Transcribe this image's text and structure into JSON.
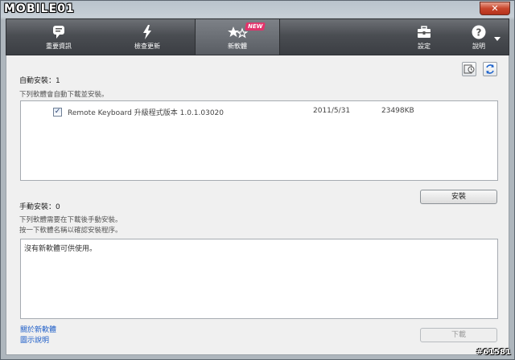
{
  "brand": {
    "logo_text": "MOBILE01"
  },
  "window": {
    "close_label": "✕"
  },
  "toolbar": {
    "items": [
      {
        "label": "重要資訊",
        "icon": "speech-bubble-icon"
      },
      {
        "label": "檢查更新",
        "icon": "lightning-icon"
      },
      {
        "label": "新軟體",
        "icon": "stars-icon",
        "badge": "NEW",
        "active": true
      },
      {
        "label": "設定",
        "icon": "toolbox-icon"
      },
      {
        "label": "說明",
        "icon": "help-icon"
      }
    ]
  },
  "auto_install": {
    "title": "自動安裝：1",
    "description": "下列軟體會自動下載並安裝。",
    "items": [
      {
        "checked": true,
        "name": "Remote Keyboard 升級程式版本 1.0.1.03020",
        "date": "2011/5/31",
        "size": "23498KB"
      }
    ],
    "install_button": "安裝"
  },
  "manual_install": {
    "title": "手動安裝：0",
    "description_line1": "下列軟體需要在下載後手動安裝。",
    "description_line2": "按一下軟體名稱以確認安裝程序。",
    "empty_message": "沒有新軟體可供使用。",
    "download_button": "下載"
  },
  "links": {
    "about": "關於新軟體",
    "legend": "圖示說明"
  },
  "watermark": "#61581",
  "colors": {
    "accent_badge": "#e2336b",
    "link": "#1e5ec8"
  }
}
